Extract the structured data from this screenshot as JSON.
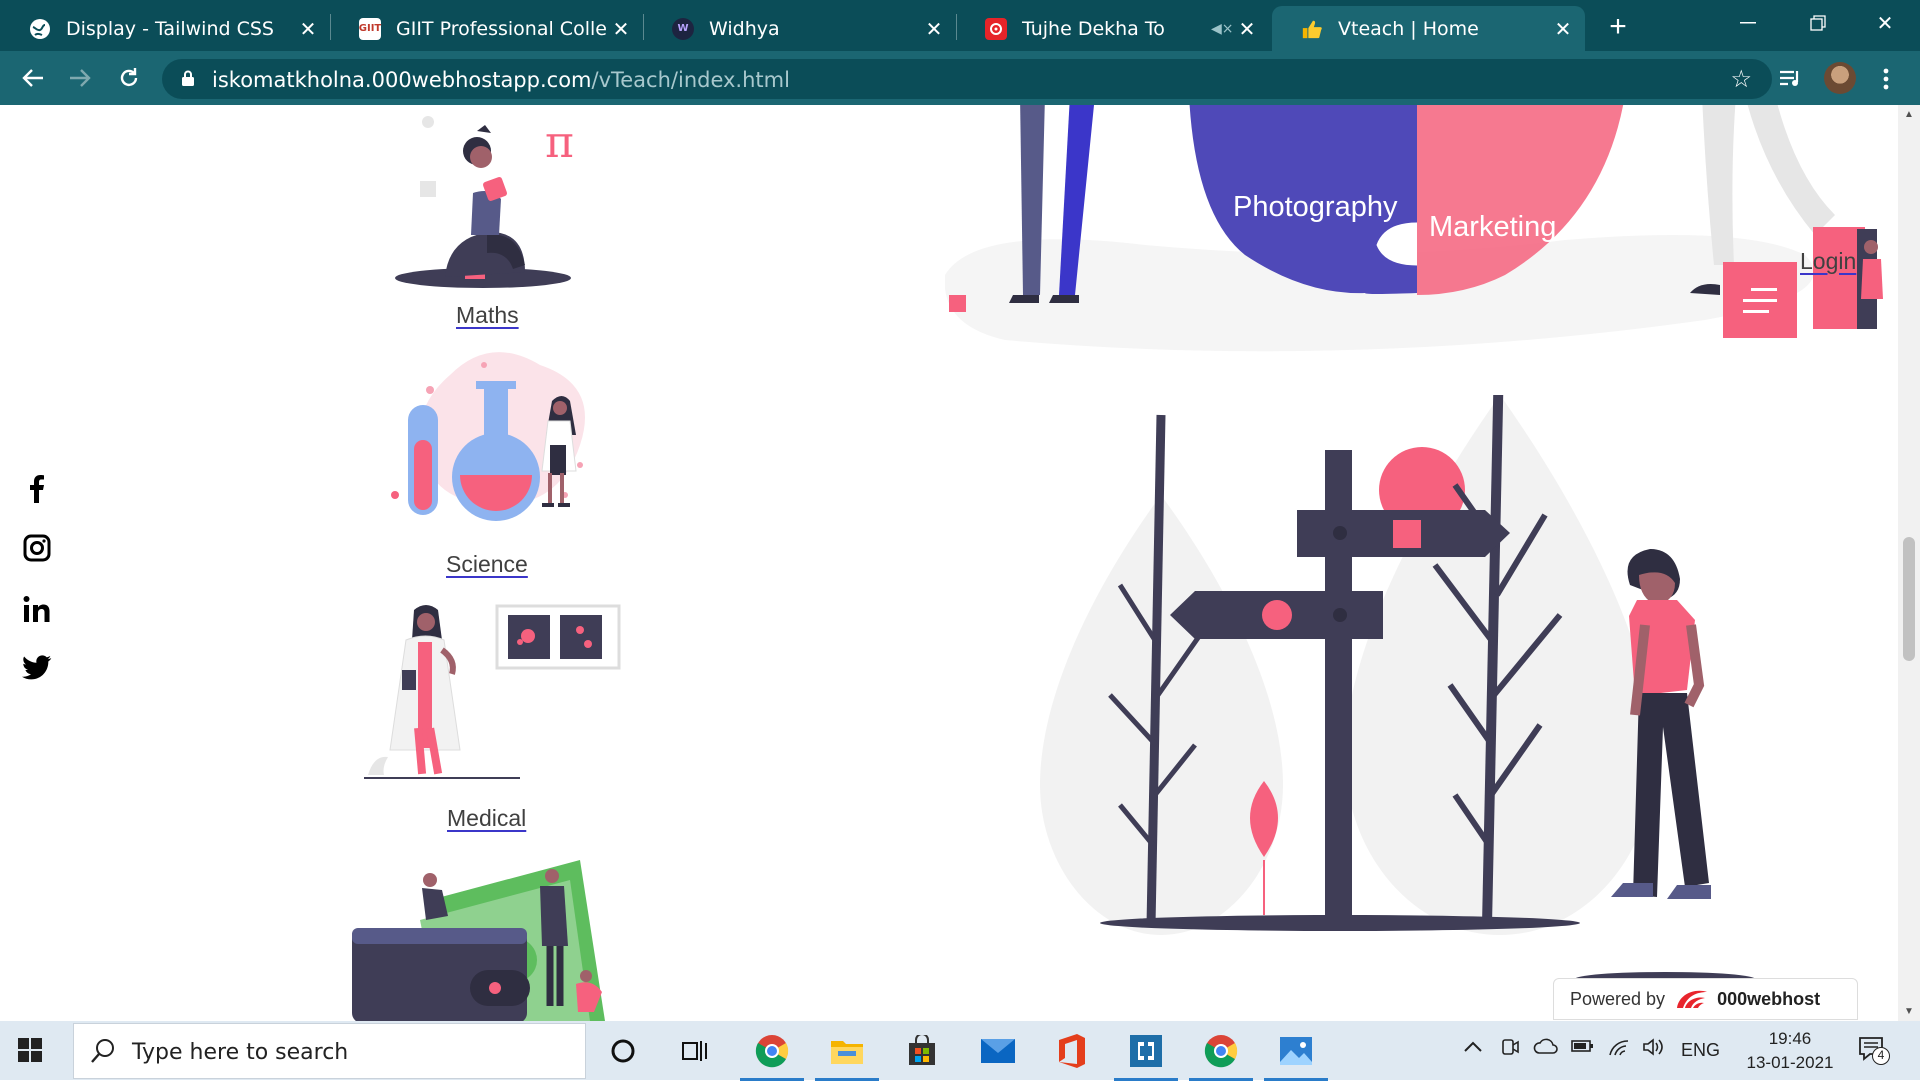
{
  "browser": {
    "tabs": [
      {
        "title": "Display - Tailwind CSS",
        "icon": "globe-icon"
      },
      {
        "title": "GIIT Professional College",
        "icon": "giit-icon",
        "favicon_text": "GIIT"
      },
      {
        "title": "Widhya",
        "icon": "widhya-icon",
        "favicon_text": "W"
      },
      {
        "title": "Tujhe Dekha To",
        "icon": "music-icon"
      },
      {
        "title": "Vteach | Home",
        "icon": "thumbs-up-icon",
        "active": true
      }
    ],
    "url_host": "iskomatkholna.000webhostapp.com",
    "url_path": "/vTeach/index.html",
    "accent": "#0b4d58"
  },
  "page": {
    "subjects": [
      {
        "label": "Maths"
      },
      {
        "label": "Science"
      },
      {
        "label": "Medical"
      }
    ],
    "puzzle_labels": {
      "left": "Photography",
      "right": "Marketing"
    },
    "login_label": "Login",
    "social": [
      "facebook-icon",
      "instagram-icon",
      "linkedin-icon",
      "twitter-icon"
    ],
    "powered_by": {
      "prefix": "Powered by",
      "brand": "000webhost"
    },
    "accent_pink": "#f6617e",
    "accent_purple": "#3b36c9"
  },
  "taskbar": {
    "search_placeholder": "Type here to search",
    "language": "ENG",
    "time": "19:46",
    "date": "13-01-2021",
    "notification_count": "4"
  }
}
